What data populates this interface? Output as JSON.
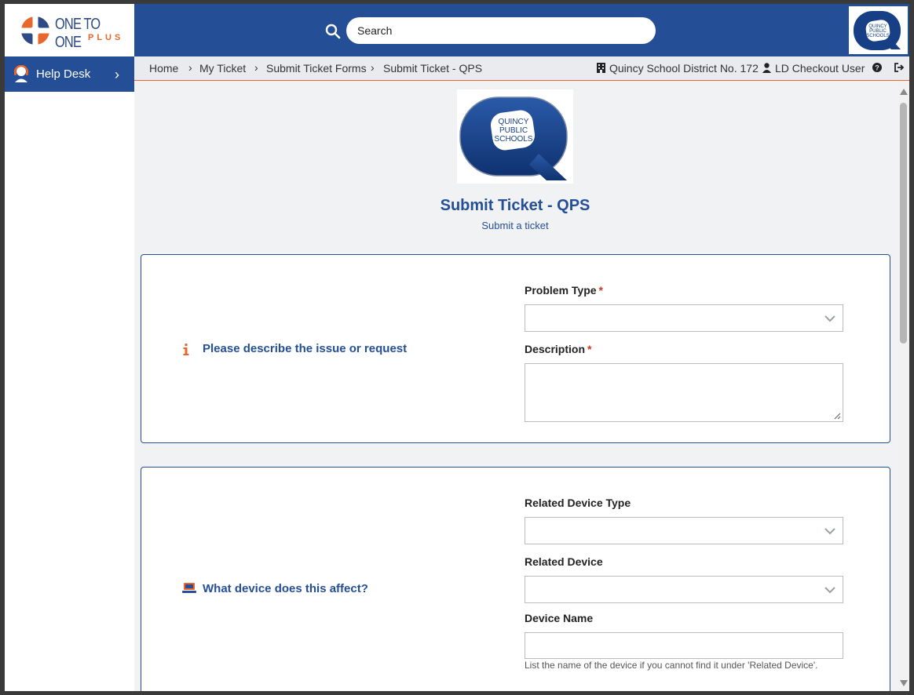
{
  "brand": {
    "line1": "ONE TO ONE",
    "line2": "PLUS",
    "accent": "#e8662c",
    "primary": "#244f96"
  },
  "search": {
    "placeholder": "Search"
  },
  "school_logo": {
    "line1": "QUINCY",
    "line2": "PUBLIC",
    "line3": "SCHOOLS"
  },
  "sidebar": {
    "items": [
      {
        "label": "Help Desk",
        "icon": "headset-icon"
      }
    ]
  },
  "breadcrumb": [
    "Home",
    "My Ticket",
    "Submit Ticket Forms",
    "Submit Ticket - QPS"
  ],
  "header_right": {
    "district": "Quincy School District No. 172",
    "user": "LD Checkout User"
  },
  "page": {
    "title": "Submit Ticket - QPS",
    "subtitle": "Submit a ticket"
  },
  "section_issue": {
    "heading": "Please describe the issue or request",
    "problem_type_label": "Problem Type",
    "description_label": "Description",
    "required_mark": "*"
  },
  "section_device": {
    "heading": "What device does this affect?",
    "device_type_label": "Related Device Type",
    "device_label": "Related Device",
    "device_name_label": "Device Name",
    "device_name_hint": "List the name of the device if you cannot find it under 'Related Device'."
  }
}
